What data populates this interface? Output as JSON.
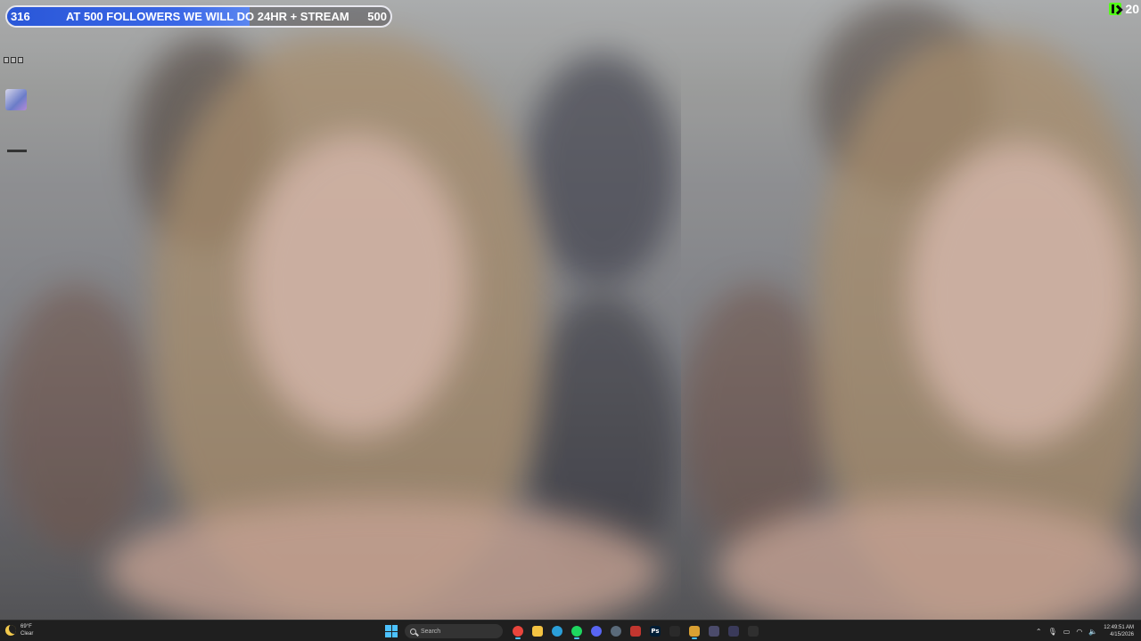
{
  "follower_goal": {
    "current": "316",
    "message": "AT 500 FOLLOWERS WE WILL DO 24HR + STREAM",
    "target": "500",
    "progress": 0.632
  },
  "kick": {
    "icon": "kick-logo-icon",
    "viewer_count": "20"
  },
  "desktop": {
    "shortcuts": [
      {
        "icon": "app-shortcut-icon"
      },
      {
        "icon": "document-shortcut-icon"
      }
    ]
  },
  "taskbar": {
    "weather": {
      "temp": "69°F",
      "condition": "Clear",
      "icon": "moon-icon"
    },
    "search_placeholder": "Search",
    "apps": [
      {
        "name": "chrome",
        "glyph": "",
        "color": "#e8453c",
        "active": true
      },
      {
        "name": "file-explorer",
        "glyph": "",
        "color": "#f4c342",
        "active": false
      },
      {
        "name": "edge",
        "glyph": "",
        "color": "#2b9fd9",
        "active": false
      },
      {
        "name": "spotify",
        "glyph": "",
        "color": "#1ed760",
        "active": true
      },
      {
        "name": "discord",
        "glyph": "",
        "color": "#5865f2",
        "active": false
      },
      {
        "name": "steam",
        "glyph": "",
        "color": "#5a6a7a",
        "active": false
      },
      {
        "name": "acrobat",
        "glyph": "",
        "color": "#c2362f",
        "active": false
      },
      {
        "name": "photoshop",
        "glyph": "Ps",
        "color": "#001e36",
        "active": false
      },
      {
        "name": "terminal",
        "glyph": "",
        "color": "#2a2a2a",
        "active": false
      },
      {
        "name": "obs",
        "glyph": "",
        "color": "#d9a032",
        "active": true
      },
      {
        "name": "app-11",
        "glyph": "",
        "color": "#4b4b6b",
        "active": false
      },
      {
        "name": "app-12",
        "glyph": "",
        "color": "#3a3a5a",
        "active": false
      },
      {
        "name": "app-13",
        "glyph": "",
        "color": "#2f2f2f",
        "active": false
      }
    ],
    "clock": {
      "time": "12:49:51 AM",
      "date": "4/15/2026"
    },
    "accent": "#4cc2ff"
  }
}
